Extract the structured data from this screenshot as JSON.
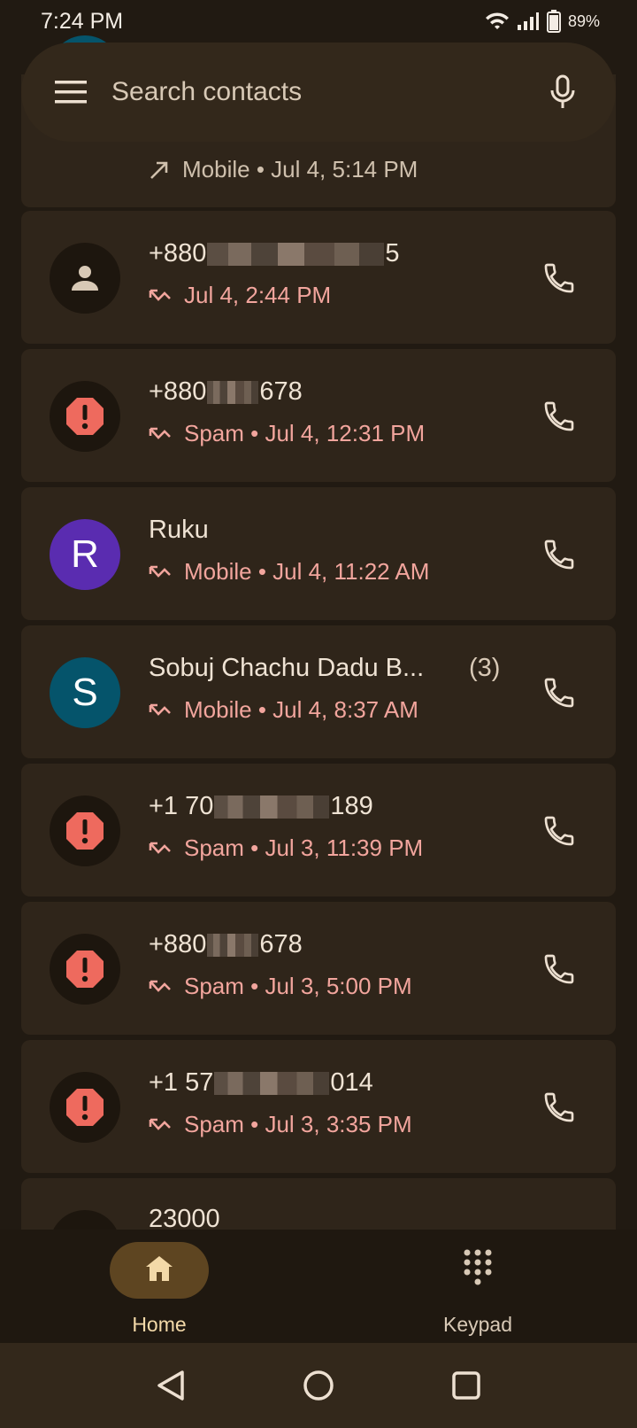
{
  "status_bar": {
    "time": "7:24 PM",
    "battery": "89%"
  },
  "search": {
    "placeholder": "Search contacts"
  },
  "calls": [
    {
      "name": "",
      "detail": "Mobile • Jul 4, 5:14 PM",
      "direction": "outgoing",
      "avatar": "letter-s",
      "letter": ""
    },
    {
      "name_prefix": "+880",
      "name_suffix": "5",
      "masked": true,
      "detail": "Jul 4, 2:44 PM",
      "direction": "missed",
      "avatar": "unknown"
    },
    {
      "name_prefix": "+880",
      "name_suffix": "678",
      "masked": true,
      "detail": "Spam • Jul 4, 12:31 PM",
      "direction": "missed",
      "avatar": "spam"
    },
    {
      "name": "Ruku",
      "detail": "Mobile • Jul 4, 11:22 AM",
      "direction": "missed",
      "avatar": "letter-r",
      "letter": "R"
    },
    {
      "name": "Sobuj Chachu Dadu B...",
      "count": "(3)",
      "detail": "Mobile • Jul 4, 8:37 AM",
      "direction": "missed",
      "avatar": "letter-s",
      "letter": "S"
    },
    {
      "name_prefix": "+1 70",
      "name_suffix": "189",
      "masked": true,
      "detail": "Spam • Jul 3, 11:39 PM",
      "direction": "missed",
      "avatar": "spam"
    },
    {
      "name_prefix": "+880",
      "name_suffix": "678",
      "masked": true,
      "detail": "Spam • Jul 3, 5:00 PM",
      "direction": "missed",
      "avatar": "spam"
    },
    {
      "name_prefix": "+1 57",
      "name_suffix": "014",
      "masked": true,
      "detail": "Spam • Jul 3, 3:35 PM",
      "direction": "missed",
      "avatar": "spam"
    },
    {
      "name": "23000",
      "detail": "",
      "direction": "missed",
      "avatar": "unknown"
    }
  ],
  "bottom_nav": {
    "home_label": "Home",
    "keypad_label": "Keypad"
  },
  "colors": {
    "accent": "#f3d9a8",
    "spam_red": "#ee6a5e",
    "missed": "#f2a59d"
  }
}
